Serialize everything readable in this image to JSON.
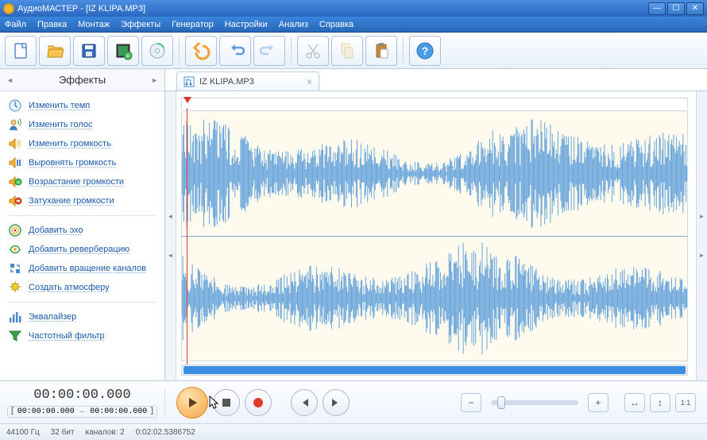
{
  "window": {
    "title": "АудиоМАСТЕР - [IZ KLIPA.MP3]"
  },
  "menu": [
    "Файл",
    "Правка",
    "Монтаж",
    "Эффекты",
    "Генератор",
    "Настройки",
    "Анализ",
    "Справка"
  ],
  "sidebar": {
    "header": "Эффекты",
    "groups": [
      [
        {
          "icon": "clock",
          "label": "Изменить темп"
        },
        {
          "icon": "user",
          "label": "Изменить голос"
        },
        {
          "icon": "speaker",
          "label": "Изменить громкость"
        },
        {
          "icon": "speaker-eq",
          "label": "Выровнять громкость"
        },
        {
          "icon": "speaker-up",
          "label": "Возрастание громкости"
        },
        {
          "icon": "speaker-down",
          "label": "Затухание громкости"
        }
      ],
      [
        {
          "icon": "echo",
          "label": "Добавить эхо"
        },
        {
          "icon": "reverb",
          "label": "Добавить реверберацию"
        },
        {
          "icon": "rotate",
          "label": "Добавить вращение каналов"
        },
        {
          "icon": "sparkle",
          "label": "Создать атмосферу"
        }
      ],
      [
        {
          "icon": "eq-bars",
          "label": "Эквалайзер"
        },
        {
          "icon": "funnel",
          "label": "Частотный фильтр"
        }
      ]
    ]
  },
  "tabs": [
    {
      "label": "IZ KLIPA.MP3"
    }
  ],
  "transport": {
    "time": "00:00:00.000",
    "range_from": "00:00:00.000",
    "range_to": "00:00:00.000"
  },
  "status": {
    "sample_rate": "44100 Гц",
    "bitdepth": "32 бит",
    "channels": "каналов: 2",
    "duration": "0:02:02.5386752"
  }
}
